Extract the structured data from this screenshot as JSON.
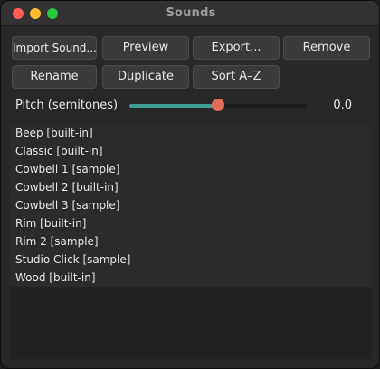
{
  "window": {
    "title": "Sounds"
  },
  "toolbar": {
    "import_label": "Import Sound...",
    "preview_label": "Preview",
    "export_label": "Export...",
    "remove_label": "Remove",
    "rename_label": "Rename",
    "duplicate_label": "Duplicate",
    "sort_label": "Sort A–Z"
  },
  "pitch": {
    "label": "Pitch (semitones)",
    "value_text": "0.0",
    "value": 0.0,
    "slider_fraction": 0.5
  },
  "sounds": [
    "Beep  [built-in]",
    "Classic  [built-in]",
    "Cowbell 1  [sample]",
    "Cowbell 2  [built-in]",
    "Cowbell 3  [sample]",
    "Rim  [built-in]",
    "Rim 2  [sample]",
    "Studio Click  [sample]",
    "Wood  [built-in]"
  ],
  "colors": {
    "slider_fill": "#3f9e94",
    "slider_thumb": "#e06b5a",
    "traffic_close": "#ff5f57",
    "traffic_minimize": "#febc2e",
    "traffic_zoom": "#28c840"
  }
}
